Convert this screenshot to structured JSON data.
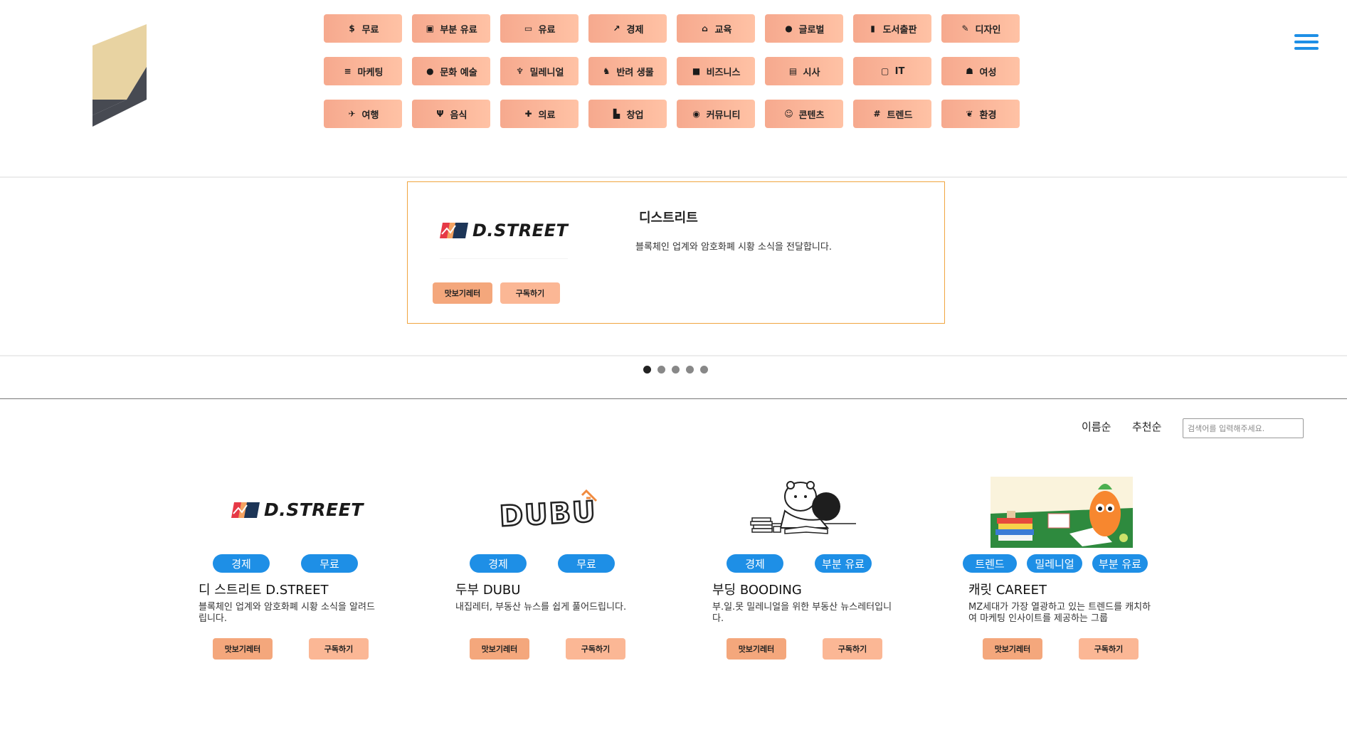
{
  "header": {
    "categories": [
      [
        {
          "label": "무료",
          "icon": "coins-icon"
        },
        {
          "label": "부분 유료",
          "icon": "money-icon"
        },
        {
          "label": "유료",
          "icon": "credit-card-icon"
        },
        {
          "label": "경제",
          "icon": "chart-line-icon"
        },
        {
          "label": "교육",
          "icon": "school-icon"
        },
        {
          "label": "글로벌",
          "icon": "globe-icon"
        },
        {
          "label": "도서출판",
          "icon": "book-icon"
        },
        {
          "label": "디자인",
          "icon": "edit-icon"
        }
      ],
      [
        {
          "label": "마케팅",
          "icon": "coins-stack-icon"
        },
        {
          "label": "문화 예술",
          "icon": "palette-icon"
        },
        {
          "label": "밀레니얼",
          "icon": "person-icon"
        },
        {
          "label": "반려 생물",
          "icon": "dog-icon"
        },
        {
          "label": "비즈니스",
          "icon": "briefcase-icon"
        },
        {
          "label": "시사",
          "icon": "newspaper-icon"
        },
        {
          "label": "IT",
          "icon": "laptop-icon"
        },
        {
          "label": "여성",
          "icon": "user-icon"
        }
      ],
      [
        {
          "label": "여행",
          "icon": "plane-icon"
        },
        {
          "label": "음식",
          "icon": "utensils-icon"
        },
        {
          "label": "의료",
          "icon": "ambulance-icon"
        },
        {
          "label": "창업",
          "icon": "door-icon"
        },
        {
          "label": "커뮤니티",
          "icon": "comments-icon"
        },
        {
          "label": "콘텐츠",
          "icon": "smile-icon"
        },
        {
          "label": "트렌드",
          "icon": "hashtag-icon"
        },
        {
          "label": "환경",
          "icon": "leaf-icon"
        }
      ]
    ]
  },
  "carousel": {
    "logo_text": "D.STREET",
    "title": "디스트리트",
    "description": "블록체인 업계와 암호화폐 시황 소식을 전달합니다.",
    "preview_label": "맛보기레터",
    "subscribe_label": "구독하기",
    "active_slide": 1,
    "slide_count": 5
  },
  "toolbar": {
    "sort_name": "이름순",
    "sort_recommend": "추천순",
    "search_placeholder": "검색어를 입력해주세요."
  },
  "cards": [
    {
      "logo_text": "D.STREET",
      "tags": [
        "경제",
        "무료"
      ],
      "title": "디 스트리트 D.STREET",
      "description": "블록체인 업계와 암호화폐 시황 소식을 알려드립니다.",
      "preview_label": "맛보기레터",
      "subscribe_label": "구독하기"
    },
    {
      "logo_text": "DUBU",
      "tags": [
        "경제",
        "무료"
      ],
      "title": "두부 DUBU",
      "description": "내집레터, 부동산 뉴스를 쉽게 풀어드립니다.",
      "preview_label": "맛보기레터",
      "subscribe_label": "구독하기"
    },
    {
      "logo_text": "",
      "tags": [
        "경제",
        "부분 유료"
      ],
      "title": "부딩 BOODING",
      "description": "부.일.못 밀레니얼을 위한 부동산 뉴스레터입니다.",
      "preview_label": "맛보기레터",
      "subscribe_label": "구독하기"
    },
    {
      "logo_text": "",
      "tags": [
        "트렌드",
        "밀레니얼",
        "부분 유료"
      ],
      "title": "캐릿 CAREET",
      "description": "MZ세대가 가장 열광하고 있는 트렌드를 캐치하여 마케팅 인사이트를 제공하는 그룹",
      "preview_label": "맛보기레터",
      "subscribe_label": "구독하기"
    }
  ],
  "colors": {
    "accent_blue": "#1e8fe6",
    "category_orange": "#f6a98e",
    "slide_border": "#f0a540"
  }
}
